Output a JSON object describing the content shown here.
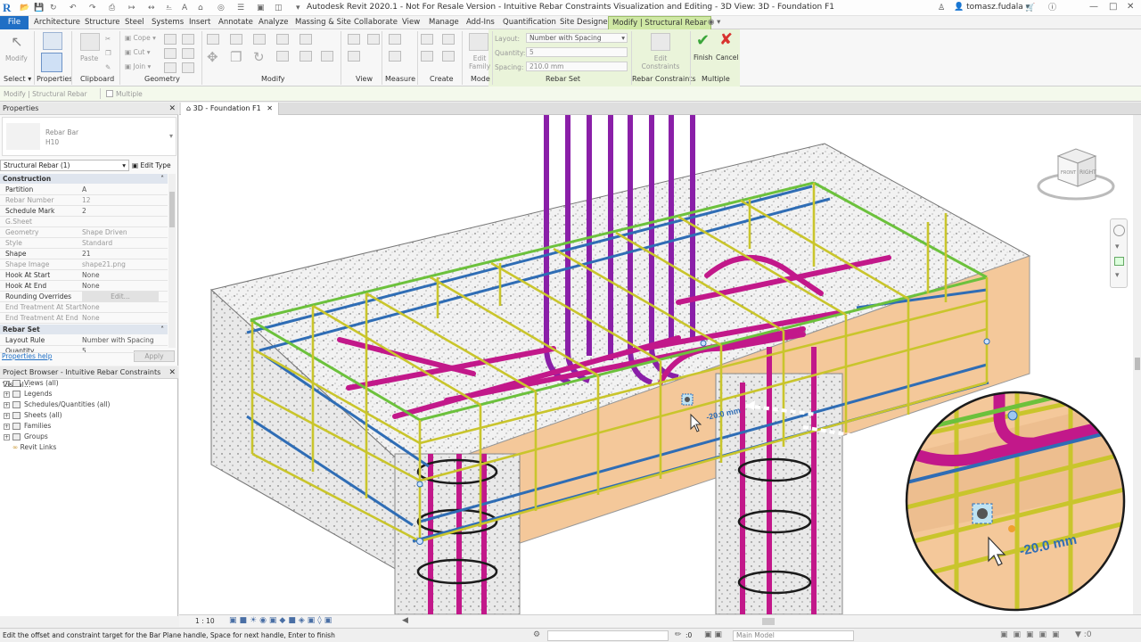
{
  "app": {
    "logo": "R",
    "title": "Autodesk Revit 2020.1 - Not For Resale Version - Intuitive Rebar Constraints Visualization and Editing - 3D View: 3D - Foundation F1",
    "user": "tomasz.fudala"
  },
  "tabs": [
    {
      "label": "File",
      "active": false
    },
    {
      "label": "Architecture"
    },
    {
      "label": "Structure"
    },
    {
      "label": "Steel"
    },
    {
      "label": "Systems"
    },
    {
      "label": "Insert"
    },
    {
      "label": "Annotate"
    },
    {
      "label": "Analyze"
    },
    {
      "label": "Massing & Site"
    },
    {
      "label": "Collaborate"
    },
    {
      "label": "View"
    },
    {
      "label": "Manage"
    },
    {
      "label": "Add-Ins"
    },
    {
      "label": "Quantification"
    },
    {
      "label": "Site Designer"
    },
    {
      "label": "Modify | Structural Rebar",
      "active": true
    }
  ],
  "ribbon": {
    "modify_label": "Modify",
    "paste_label": "Paste",
    "cope_label": "Cope",
    "cut_label": "Cut",
    "join_label": "Join",
    "layout_label": "Layout:",
    "layout_value": "Number with Spacing",
    "quantity_label": "Quantity:",
    "quantity_value": "5",
    "spacing_label": "Spacing:",
    "spacing_value": "210.0 mm",
    "edit_family_label": "Edit Family",
    "edit_constraints_label": "Edit Constraints",
    "finish_label": "Finish",
    "cancel_label": "Cancel",
    "panels": [
      "Select",
      "Properties",
      "Clipboard",
      "Geometry",
      "Modify",
      "View",
      "Measure",
      "Create",
      "Mode",
      "Rebar Set",
      "Rebar Constraints",
      "Multiple"
    ]
  },
  "options_bar": {
    "context": "Modify | Structural Rebar",
    "multiple_label": "Multiple"
  },
  "properties": {
    "title": "Properties",
    "type_family": "Rebar Bar",
    "type_name": "H10",
    "instance_selector": "Structural Rebar (1)",
    "edit_type": "Edit Type",
    "groups": [
      {
        "name": "Construction",
        "rows": [
          {
            "name": "Partition",
            "value": "A"
          },
          {
            "name": "Rebar Number",
            "value": "12",
            "dim": true
          },
          {
            "name": "Schedule Mark",
            "value": "2"
          },
          {
            "name": "G.Sheet",
            "value": "",
            "dim": true
          },
          {
            "name": "Geometry",
            "value": "Shape Driven",
            "dim": true
          },
          {
            "name": "Style",
            "value": "Standard",
            "dim": true
          },
          {
            "name": "Shape",
            "value": "21"
          },
          {
            "name": "Shape Image",
            "value": "shape21.png",
            "dim": true
          },
          {
            "name": "Hook At Start",
            "value": "None"
          },
          {
            "name": "Hook At End",
            "value": "None"
          },
          {
            "name": "Rounding Overrides",
            "value": "Edit..."
          },
          {
            "name": "End Treatment At Start",
            "value": "None",
            "dim": true
          },
          {
            "name": "End Treatment At End",
            "value": "None",
            "dim": true
          }
        ]
      },
      {
        "name": "Rebar Set",
        "rows": [
          {
            "name": "Layout Rule",
            "value": "Number with Spacing"
          },
          {
            "name": "Quantity",
            "value": "5"
          }
        ]
      }
    ],
    "help": "Properties help",
    "apply": "Apply"
  },
  "browser": {
    "title": "Project Browser - Intuitive Rebar Constraints Visual...",
    "items": [
      "Views (all)",
      "Legends",
      "Schedules/Quantities (all)",
      "Sheets (all)",
      "Families",
      "Groups",
      "Revit Links"
    ]
  },
  "view": {
    "tab": "3D - Foundation F1",
    "scale": "1 : 10",
    "dimension": "-20.0 mm",
    "dimension_zoom": "-20.0 mm",
    "viewcube_front": "FRONT",
    "viewcube_right": "RIGHT"
  },
  "status": {
    "text": "Edit the offset and constraint target for the Bar Plane handle, Space for next handle, Enter to finish",
    "zero": ":0",
    "model": "Main Model"
  },
  "colors": {
    "accent": "#1f6fc5",
    "context_tab": "#cfe8a4",
    "rebar_yellow": "#d7d53a",
    "rebar_magenta": "#c2188a",
    "rebar_purple": "#8a1fa8",
    "rebar_blue": "#2f6db5",
    "rebar_green": "#6cc13c",
    "concrete_cut": "#f4c89a"
  }
}
